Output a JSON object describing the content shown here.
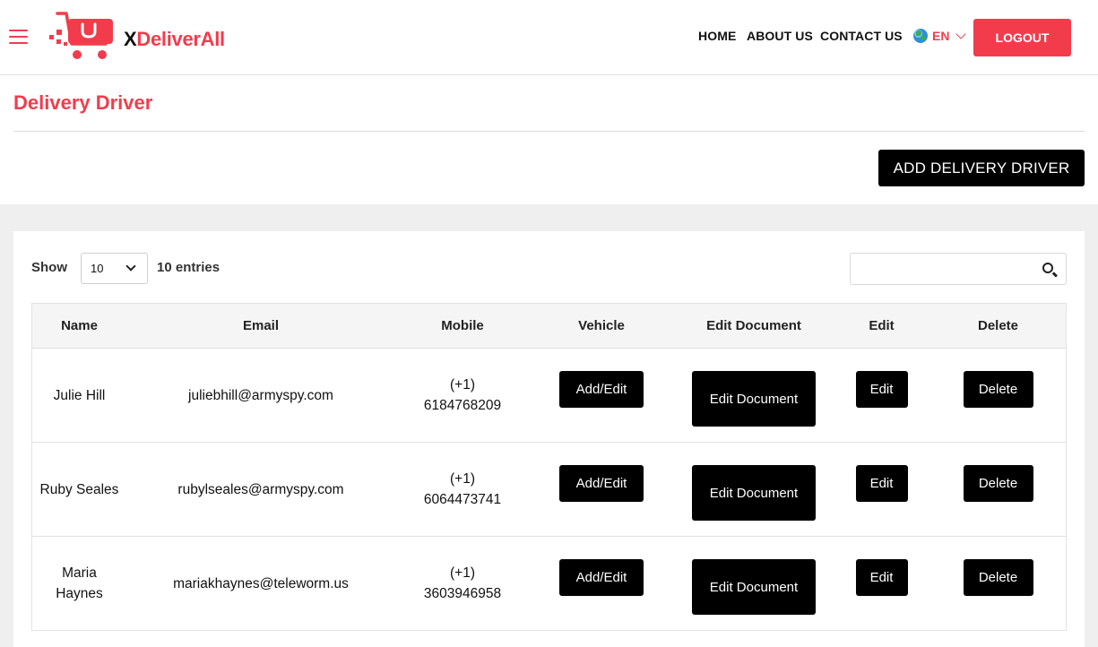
{
  "header": {
    "brand_x": "X",
    "brand_rest": "DeliverAll",
    "nav": [
      "HOME",
      "ABOUT US",
      "CONTACT US"
    ],
    "language": "EN",
    "logout_label": "LOGOUT",
    "accent_color": "#f23c4c"
  },
  "page": {
    "title": "Delivery Driver",
    "add_button_label": "ADD DELIVERY DRIVER"
  },
  "table_controls": {
    "show_label": "Show",
    "page_size": "10",
    "entries_label": "10 entries",
    "search_placeholder": ""
  },
  "table": {
    "columns": [
      "Name",
      "Email",
      "Mobile",
      "Vehicle",
      "Edit Document",
      "Edit",
      "Delete"
    ],
    "rows": [
      {
        "name": "Julie Hill",
        "email": "juliebhill@armyspy.com",
        "mobile_code": "(+1)",
        "mobile_number": "6184768209",
        "vehicle_btn": "Add/Edit",
        "doc_btn": "Edit Document",
        "edit_btn": "Edit",
        "delete_btn": "Delete"
      },
      {
        "name": "Ruby Seales",
        "email": "rubylseales@armyspy.com",
        "mobile_code": "(+1)",
        "mobile_number": "6064473741",
        "vehicle_btn": "Add/Edit",
        "doc_btn": "Edit Document",
        "edit_btn": "Edit",
        "delete_btn": "Delete"
      },
      {
        "name": "Maria Haynes",
        "email": "mariakhaynes@teleworm.us",
        "mobile_code": "(+1)",
        "mobile_number": "3603946958",
        "vehicle_btn": "Add/Edit",
        "doc_btn": "Edit Document",
        "edit_btn": "Edit",
        "delete_btn": "Delete"
      }
    ]
  }
}
